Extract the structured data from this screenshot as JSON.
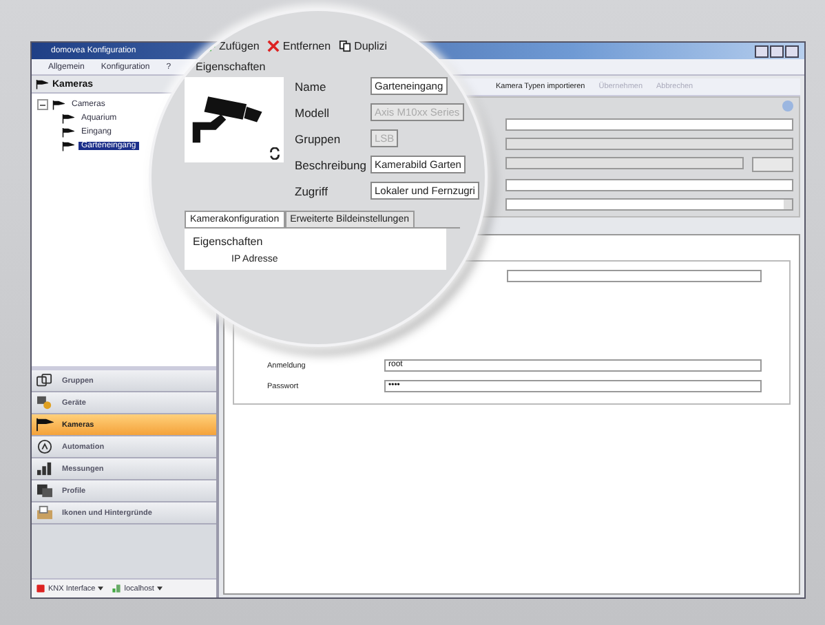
{
  "window": {
    "title": "domovea Konfiguration"
  },
  "menu": [
    "Allgemein",
    "Konfiguration",
    "?"
  ],
  "sidebar": {
    "title": "Kameras",
    "tree": [
      {
        "label": "Cameras",
        "expanded": true,
        "selected": false,
        "children": [
          {
            "label": "Aquarium",
            "selected": false
          },
          {
            "label": "Eingang",
            "selected": false
          },
          {
            "label": "Garteneingang",
            "selected": true
          }
        ]
      }
    ],
    "nav": [
      {
        "label": "Gruppen",
        "selected": false
      },
      {
        "label": "Geräte",
        "selected": false
      },
      {
        "label": "Kameras",
        "selected": true
      },
      {
        "label": "Automation",
        "selected": false
      },
      {
        "label": "Messungen",
        "selected": false
      },
      {
        "label": "Profile",
        "selected": false
      },
      {
        "label": "Ikonen und Hintergründe",
        "selected": false
      }
    ]
  },
  "status_bar": [
    {
      "label": "KNX Interface"
    },
    {
      "label": "localhost"
    }
  ],
  "toolbar": [
    {
      "label": "Kamera Typen importieren",
      "disabled": false
    },
    {
      "label": "Übernehmen",
      "disabled": true
    },
    {
      "label": "Abbrechen",
      "disabled": true
    }
  ],
  "form": {
    "fields": [
      {
        "label": "Anmeldung",
        "value": "root"
      },
      {
        "label": "Passwort",
        "value": "••••"
      }
    ]
  },
  "magnifier": {
    "toolbar": [
      {
        "label": "Zufügen"
      },
      {
        "label": "Entfernen"
      },
      {
        "label": "Duplizi"
      }
    ],
    "section": "Eigenschaften",
    "fields": [
      {
        "label": "Name",
        "value": "Garteneingang",
        "disabled": false
      },
      {
        "label": "Modell",
        "value": "Axis M10xx Series",
        "disabled": true
      },
      {
        "label": "Gruppen",
        "value": "LSB",
        "disabled": true
      },
      {
        "label": "Beschreibung",
        "value": "Kamerabild Garten",
        "disabled": false
      },
      {
        "label": "Zugriff",
        "value": "Lokaler und Fernzugri",
        "disabled": false
      }
    ],
    "tabs": [
      {
        "label": "Kamerakonfiguration",
        "selected": true
      },
      {
        "label": "Erweiterte Bildeinstellungen",
        "selected": false
      }
    ],
    "group": "Eigenschaften",
    "group_fields": [
      "IP Adresse"
    ]
  }
}
